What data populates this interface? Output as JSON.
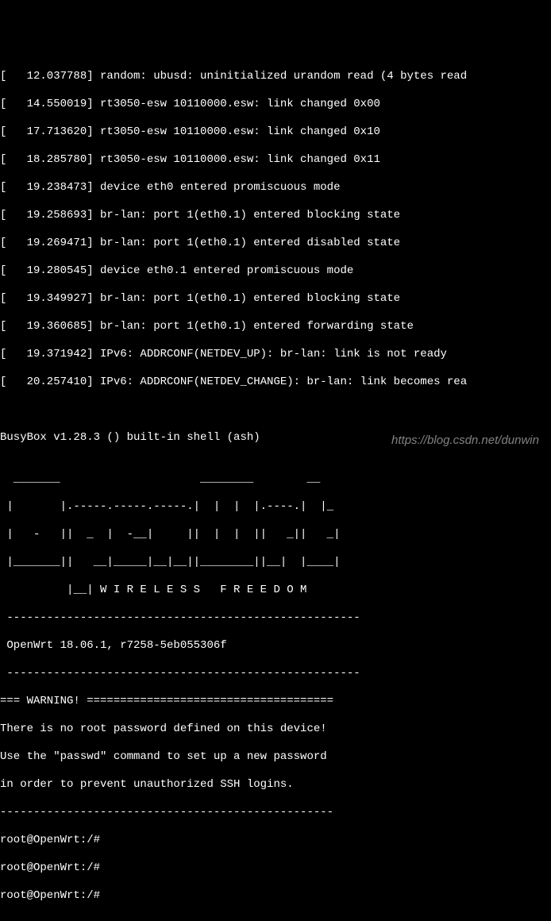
{
  "kernel_logs": [
    "[   12.037788] random: ubusd: uninitialized urandom read (4 bytes read",
    "[   14.550019] rt3050-esw 10110000.esw: link changed 0x00",
    "[   17.713620] rt3050-esw 10110000.esw: link changed 0x10",
    "[   18.285780] rt3050-esw 10110000.esw: link changed 0x11",
    "[   19.238473] device eth0 entered promiscuous mode",
    "[   19.258693] br-lan: port 1(eth0.1) entered blocking state",
    "[   19.269471] br-lan: port 1(eth0.1) entered disabled state",
    "[   19.280545] device eth0.1 entered promiscuous mode",
    "[   19.349927] br-lan: port 1(eth0.1) entered blocking state",
    "[   19.360685] br-lan: port 1(eth0.1) entered forwarding state",
    "[   19.371942] IPv6: ADDRCONF(NETDEV_UP): br-lan: link is not ready",
    "[   20.257410] IPv6: ADDRCONF(NETDEV_CHANGE): br-lan: link becomes rea"
  ],
  "blank1": "",
  "blank2": "",
  "busybox": "BusyBox v1.28.3 () built-in shell (ash)",
  "blank3": "",
  "ascii_art": [
    "  _______                     ________        __",
    " |       |.-----.-----.-----.|  |  |  |.----.|  |_",
    " |   -   ||  _  |  -__|     ||  |  |  ||   _||   _|",
    " |_______||   __|_____|__|__||________||__|  |____|",
    "          |__| W I R E L E S S   F R E E D O M"
  ],
  "separator1": " -----------------------------------------------------",
  "version": " OpenWrt 18.06.1, r7258-5eb055306f",
  "separator2": " -----------------------------------------------------",
  "warning_header": "=== WARNING! =====================================",
  "warning_lines": [
    "There is no root password defined on this device!",
    "Use the \"passwd\" command to set up a new password",
    "in order to prevent unauthorized SSH logins."
  ],
  "separator3": "--------------------------------------------------",
  "prompts": [
    "root@OpenWrt:/#",
    "root@OpenWrt:/#",
    "root@OpenWrt:/#"
  ],
  "watermark": "https://blog.csdn.net/dunwin"
}
